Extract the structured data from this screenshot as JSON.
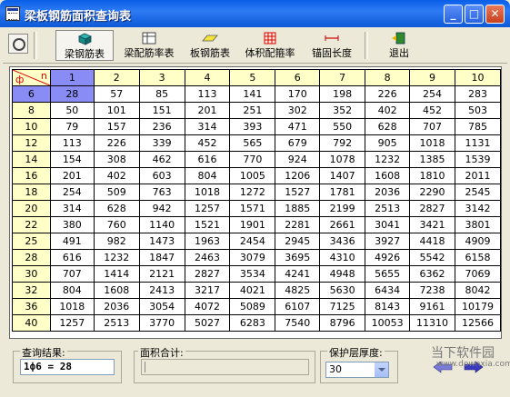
{
  "window": {
    "title": "梁板钢筋面积查询表"
  },
  "toolbar": {
    "beam_rebar": "梁钢筋表",
    "beam_ratio": "梁配筋率表",
    "slab_rebar": "板钢筋表",
    "volume_ratio": "体积配箍率",
    "anchor_length": "锚固长度",
    "exit": "退出"
  },
  "grid": {
    "corner_top": "n",
    "corner_bottom": "ф",
    "columns": [
      "1",
      "2",
      "3",
      "4",
      "5",
      "6",
      "7",
      "8",
      "9",
      "10"
    ],
    "rows": [
      {
        "d": "6",
        "v": [
          "28",
          "57",
          "85",
          "113",
          "141",
          "170",
          "198",
          "226",
          "254",
          "283"
        ]
      },
      {
        "d": "8",
        "v": [
          "50",
          "101",
          "151",
          "201",
          "251",
          "302",
          "352",
          "402",
          "452",
          "503"
        ]
      },
      {
        "d": "10",
        "v": [
          "79",
          "157",
          "236",
          "314",
          "393",
          "471",
          "550",
          "628",
          "707",
          "785"
        ]
      },
      {
        "d": "12",
        "v": [
          "113",
          "226",
          "339",
          "452",
          "565",
          "679",
          "792",
          "905",
          "1018",
          "1131"
        ]
      },
      {
        "d": "14",
        "v": [
          "154",
          "308",
          "462",
          "616",
          "770",
          "924",
          "1078",
          "1232",
          "1385",
          "1539"
        ]
      },
      {
        "d": "16",
        "v": [
          "201",
          "402",
          "603",
          "804",
          "1005",
          "1206",
          "1407",
          "1608",
          "1810",
          "2011"
        ]
      },
      {
        "d": "18",
        "v": [
          "254",
          "509",
          "763",
          "1018",
          "1272",
          "1527",
          "1781",
          "2036",
          "2290",
          "2545"
        ]
      },
      {
        "d": "20",
        "v": [
          "314",
          "628",
          "942",
          "1257",
          "1571",
          "1885",
          "2199",
          "2513",
          "2827",
          "3142"
        ]
      },
      {
        "d": "22",
        "v": [
          "380",
          "760",
          "1140",
          "1521",
          "1901",
          "2281",
          "2661",
          "3041",
          "3421",
          "3801"
        ]
      },
      {
        "d": "25",
        "v": [
          "491",
          "982",
          "1473",
          "1963",
          "2454",
          "2945",
          "3436",
          "3927",
          "4418",
          "4909"
        ]
      },
      {
        "d": "28",
        "v": [
          "616",
          "1232",
          "1847",
          "2463",
          "3079",
          "3695",
          "4310",
          "4926",
          "5542",
          "6158"
        ]
      },
      {
        "d": "30",
        "v": [
          "707",
          "1414",
          "2121",
          "2827",
          "3534",
          "4241",
          "4948",
          "5655",
          "6362",
          "7069"
        ]
      },
      {
        "d": "32",
        "v": [
          "804",
          "1608",
          "2413",
          "3217",
          "4021",
          "4825",
          "5630",
          "6434",
          "7238",
          "8042"
        ]
      },
      {
        "d": "36",
        "v": [
          "1018",
          "2036",
          "3054",
          "4072",
          "5089",
          "6107",
          "7125",
          "8143",
          "9161",
          "10179"
        ]
      },
      {
        "d": "40",
        "v": [
          "1257",
          "2513",
          "3770",
          "5027",
          "6283",
          "7540",
          "8796",
          "10053",
          "11310",
          "12566"
        ]
      }
    ]
  },
  "status": {
    "query_label": "查询结果:",
    "query_value": "1ф6 = 28",
    "area_label": "面积合计:",
    "cover_label": "保护层厚度:",
    "cover_value": "30"
  },
  "watermark": {
    "text": "当下软件园",
    "sub": "www.downxia.com"
  },
  "colors": {
    "header_bg": "#FFFFC8",
    "selected": "#8A8CF5",
    "title_bar": "#0A5FE8"
  }
}
